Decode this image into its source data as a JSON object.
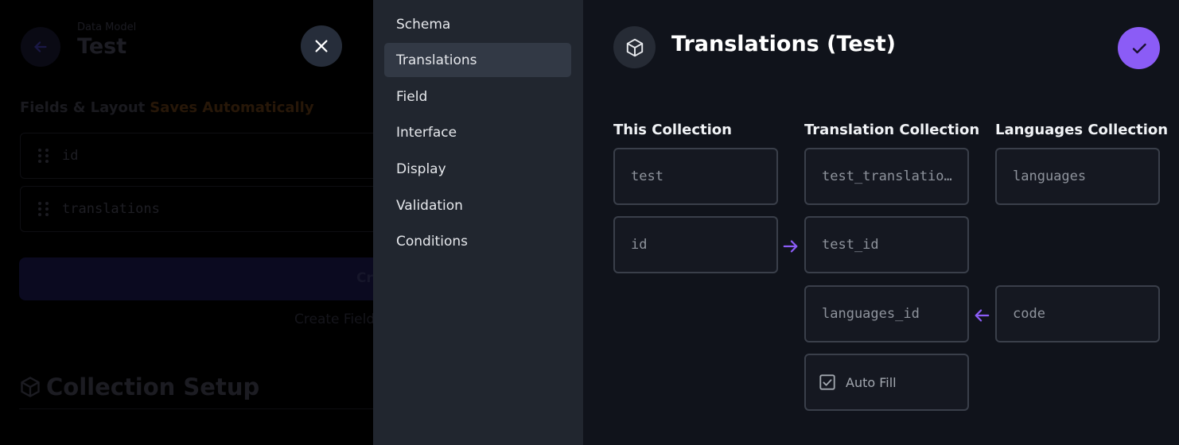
{
  "background": {
    "kicker": "Data Model",
    "title": "Test",
    "section_title": "Fields & Layout",
    "saves_label": "Saves Automatically",
    "fields": [
      {
        "name": "id"
      },
      {
        "name": "translations"
      }
    ],
    "create_button_label": "Cr",
    "create_link": "Create Field",
    "setup_title": "Collection Setup"
  },
  "nav": {
    "items": [
      {
        "label": "Schema",
        "active": false
      },
      {
        "label": "Translations",
        "active": true
      },
      {
        "label": "Field",
        "active": false
      },
      {
        "label": "Interface",
        "active": false
      },
      {
        "label": "Display",
        "active": false
      },
      {
        "label": "Validation",
        "active": false
      },
      {
        "label": "Conditions",
        "active": false
      }
    ]
  },
  "drawer": {
    "title": "Translations (Test)",
    "icon": "cube-icon",
    "confirm_icon": "check-icon",
    "accent_color": "#8b5cf6",
    "columns": {
      "this": "This Collection",
      "translation": "Translation Collection",
      "languages": "Languages Collection"
    },
    "fields": {
      "this_collection": "test",
      "this_key": "id",
      "translation_collection": "test_translations",
      "translation_fk_this": "test_id",
      "translation_fk_languages": "languages_id",
      "languages_collection": "languages",
      "languages_key": "code"
    },
    "auto_fill": {
      "label": "Auto Fill",
      "checked": true
    }
  }
}
